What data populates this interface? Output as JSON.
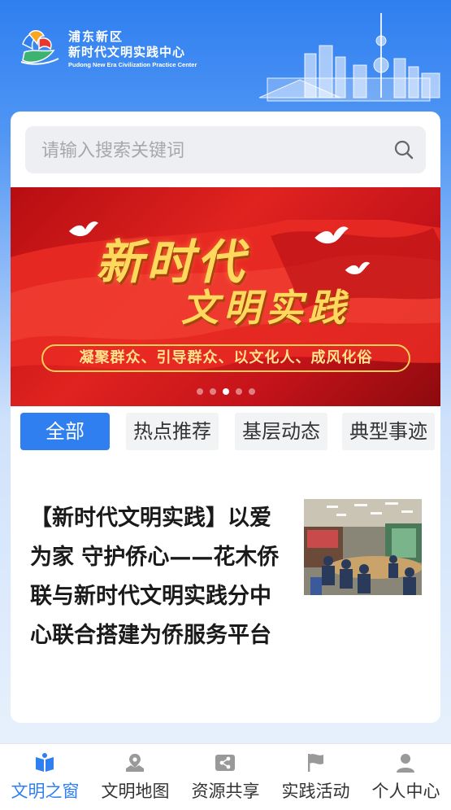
{
  "header": {
    "name_line1": "浦东新区",
    "name_line2": "新时代文明实践中心",
    "name_en": "Pudong New Era Civilization Practice Center",
    "logo_icon": "pudong-logo-icon"
  },
  "search": {
    "placeholder": "请输入搜索关键词",
    "icon": "search-icon"
  },
  "banner": {
    "title_line1": "新时代",
    "title_line2": "文明实践",
    "slogan": "凝聚群众、引导群众、以文化人、成风化俗",
    "dot_count": 5,
    "active_dot_index": 2
  },
  "tabs": [
    {
      "label": "全部",
      "active": true
    },
    {
      "label": "热点推荐",
      "active": false
    },
    {
      "label": "基层动态",
      "active": false
    },
    {
      "label": "典型事迹",
      "active": false
    }
  ],
  "article": {
    "title": "【新时代文明实践】以爱为家 守护侨心——花木侨联与新时代文明实践分中心联合搭建为侨服务平台"
  },
  "tabbar": [
    {
      "label": "文明之窗",
      "icon": "book-icon",
      "active": true
    },
    {
      "label": "文明地图",
      "icon": "map-pin-icon",
      "active": false
    },
    {
      "label": "资源共享",
      "icon": "share-icon",
      "active": false
    },
    {
      "label": "实践活动",
      "icon": "flag-icon",
      "active": false
    },
    {
      "label": "个人中心",
      "icon": "user-icon",
      "active": false
    }
  ],
  "colors": {
    "primary": "#2f7ff0",
    "banner_red": "#d81e1e",
    "banner_gold": "#ffd95e"
  }
}
